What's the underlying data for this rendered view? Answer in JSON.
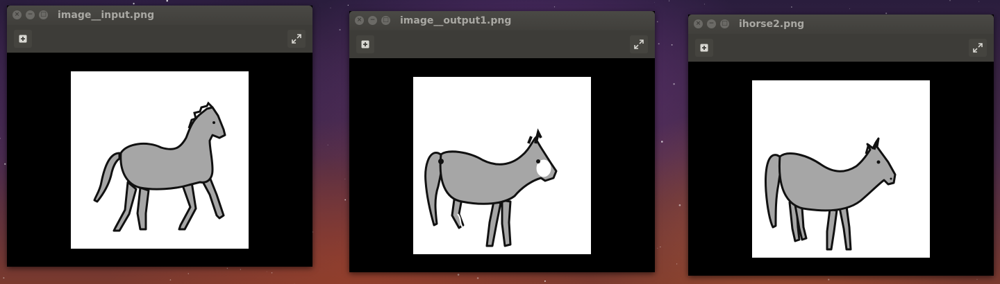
{
  "desktop": {
    "wallpaper": "starry-night-sky"
  },
  "windows": [
    {
      "title": "image__input.png",
      "buttons": {
        "close": "×",
        "minimize": "−",
        "maximize": "□"
      },
      "toolbar": {
        "add_icon": "plus-square-icon",
        "expand_icon": "expand-arrows-icon"
      }
    },
    {
      "title": "image__output1.png",
      "buttons": {
        "close": "×",
        "minimize": "−",
        "maximize": "□"
      },
      "toolbar": {
        "add_icon": "plus-square-icon",
        "expand_icon": "expand-arrows-icon"
      }
    },
    {
      "title": "ihorse2.png",
      "buttons": {
        "close": "×",
        "minimize": "−",
        "maximize": "□"
      },
      "toolbar": {
        "add_icon": "plus-square-icon",
        "expand_icon": "expand-arrows-icon"
      }
    }
  ],
  "colors": {
    "horse_fill": "#a6a6a6",
    "horse_outline": "#111111",
    "titlebar": "#45443f",
    "title_text": "#a9a8a3"
  }
}
